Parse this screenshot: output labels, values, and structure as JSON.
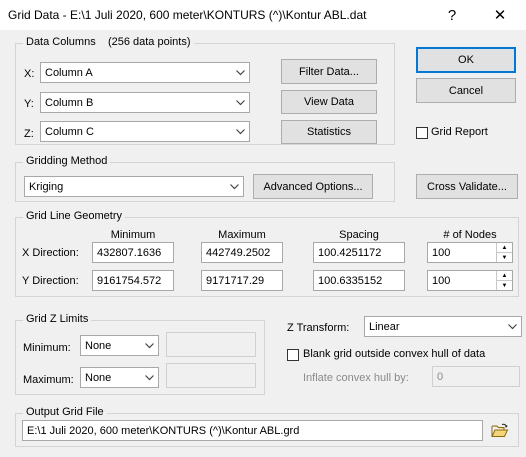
{
  "window": {
    "title": "Grid Data - E:\\1 Juli 2020, 600 meter\\KONTURS (^)\\Kontur ABL.dat",
    "help_glyph": "?",
    "close_glyph": "✕"
  },
  "data_columns": {
    "label": "Data Columns",
    "count": "(256 data points)",
    "x_label": "X:",
    "x_value": "Column A",
    "y_label": "Y:",
    "y_value": "Column B",
    "z_label": "Z:",
    "z_value": "Column C",
    "filter_button": "Filter Data...",
    "view_button": "View Data",
    "stats_button": "Statistics"
  },
  "actions": {
    "ok": "OK",
    "cancel": "Cancel",
    "grid_report": "Grid Report",
    "grid_report_checked": false,
    "cross_validate": "Cross Validate..."
  },
  "gridding": {
    "label": "Gridding Method",
    "method": "Kriging",
    "advanced_button": "Advanced Options..."
  },
  "geometry": {
    "label": "Grid Line Geometry",
    "headers": {
      "min": "Minimum",
      "max": "Maximum",
      "spacing": "Spacing",
      "nodes": "# of Nodes"
    },
    "x": {
      "label": "X Direction:",
      "min": "432807.1636",
      "max": "442749.2502",
      "spacing": "100.4251172",
      "nodes": "100"
    },
    "y": {
      "label": "Y Direction:",
      "min": "9161754.572",
      "max": "9171717.29",
      "spacing": "100.6335152",
      "nodes": "100"
    }
  },
  "zlimits": {
    "label": "Grid Z Limits",
    "min_label": "Minimum:",
    "min_value": "None",
    "max_label": "Maximum:",
    "max_value": "None"
  },
  "ztransform": {
    "label": "Z Transform:",
    "value": "Linear",
    "blank_label": "Blank grid outside convex hull of data",
    "blank_checked": false,
    "inflate_label": "Inflate convex hull by:",
    "inflate_value": "0"
  },
  "output": {
    "label": "Output Grid File",
    "path": "E:\\1 Juli 2020, 600 meter\\KONTURS (^)\\Kontur ABL.grd",
    "browse_icon": "open-folder-icon"
  }
}
